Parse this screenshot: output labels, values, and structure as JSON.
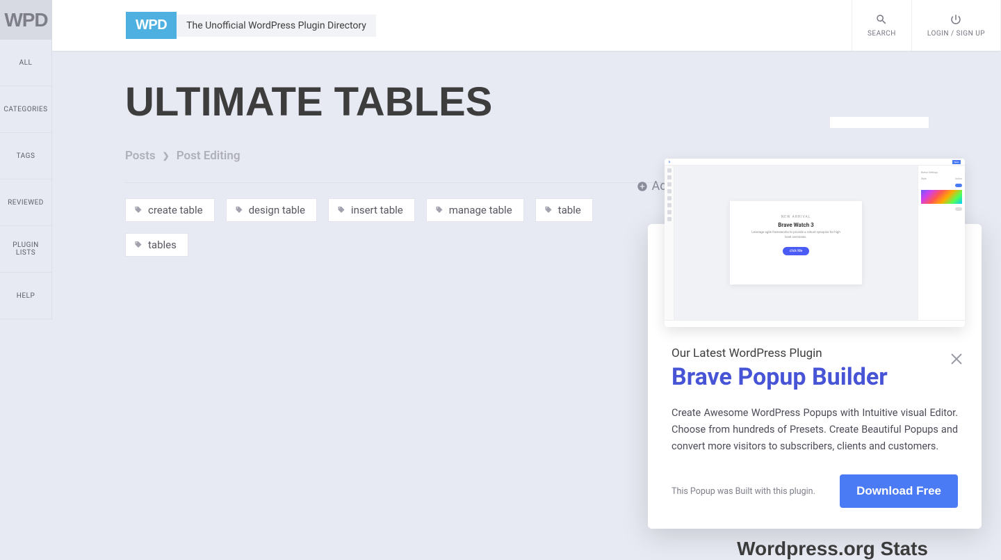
{
  "brand": {
    "short": "WPD",
    "badge": "WPD",
    "tagline": "The Unofficial WordPress Plugin Directory"
  },
  "topbar": {
    "search": "SEARCH",
    "login": "LOGIN / SIGN UP"
  },
  "sidebar": {
    "items": [
      "ALL",
      "CATEGORIES",
      "TAGS",
      "REVIEWED",
      "PLUGIN LISTS",
      "HELP"
    ]
  },
  "page": {
    "title": "ULTIMATE TABLES"
  },
  "breadcrumb": {
    "root": "Posts",
    "current": "Post Editing"
  },
  "actions": {
    "add_to": "Add to"
  },
  "tags": [
    "create table",
    "design table",
    "insert table",
    "manage table",
    "table",
    "tables"
  ],
  "right": {
    "stats_heading": "Wordpress.org Stats"
  },
  "popup": {
    "subheading": "Our Latest WordPress Plugin",
    "title": "Brave Popup Builder",
    "description": "Create Awesome WordPress Popups with Intuitive visual Editor. Choose from hundreds of Presets. Create Beautiful Popups and convert more visitors to subscribers, clients and customers.",
    "note": "This Popup was Built with this plugin.",
    "cta": "Download Free",
    "mock": {
      "kicker": "NEW ARRIVAL",
      "headline": "Brave Watch 3",
      "body": "Leverage agile frameworks to provide a robust synopsis for high level overviews.",
      "btn": "click Me",
      "save": "Save"
    }
  }
}
